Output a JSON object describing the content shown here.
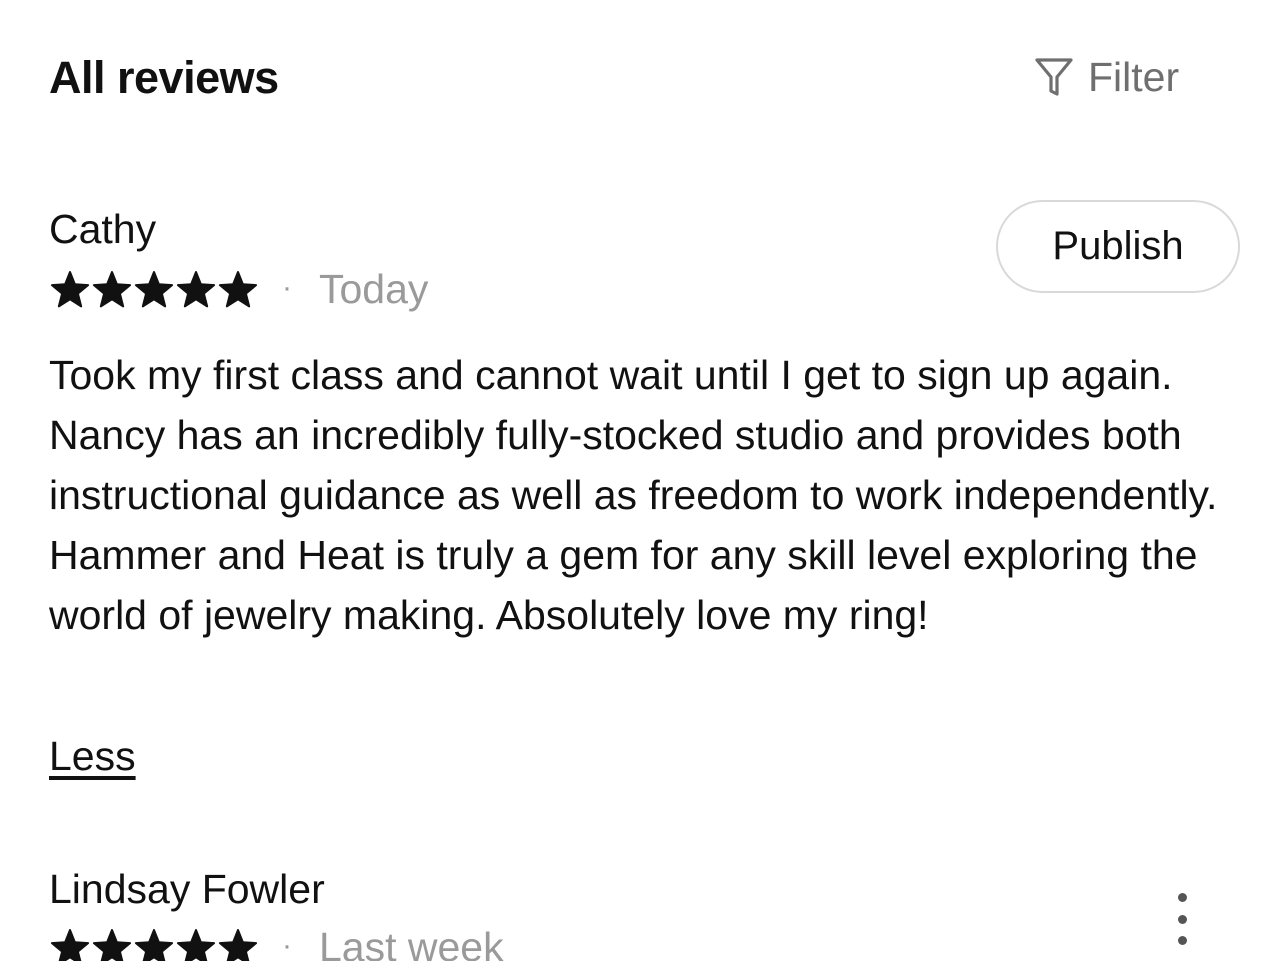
{
  "header": {
    "title": "All reviews",
    "filter_label": "Filter"
  },
  "reviews": [
    {
      "name": "Cathy",
      "rating": 5,
      "separator": "·",
      "date": "Today",
      "publish_label": "Publish",
      "text": "Took my first class and cannot wait until I get to sign up again. Nancy has an incredibly fully-stocked studio and provides both instructional guidance as well as freedom to work independently. Hammer and Heat is truly a gem for any skill level exploring the world of jewelry making. Absolutely love my ring!",
      "toggle_label": "Less"
    },
    {
      "name": "Lindsay Fowler",
      "rating": 5,
      "separator": "·",
      "date": "Last week"
    }
  ],
  "icons": {
    "filter": "filter-icon",
    "star": "star-icon",
    "more": "more-vertical-icon"
  },
  "colors": {
    "text": "#111111",
    "muted": "#6f6f6f",
    "date": "#9a9a9a",
    "border": "#d9d9d9"
  }
}
